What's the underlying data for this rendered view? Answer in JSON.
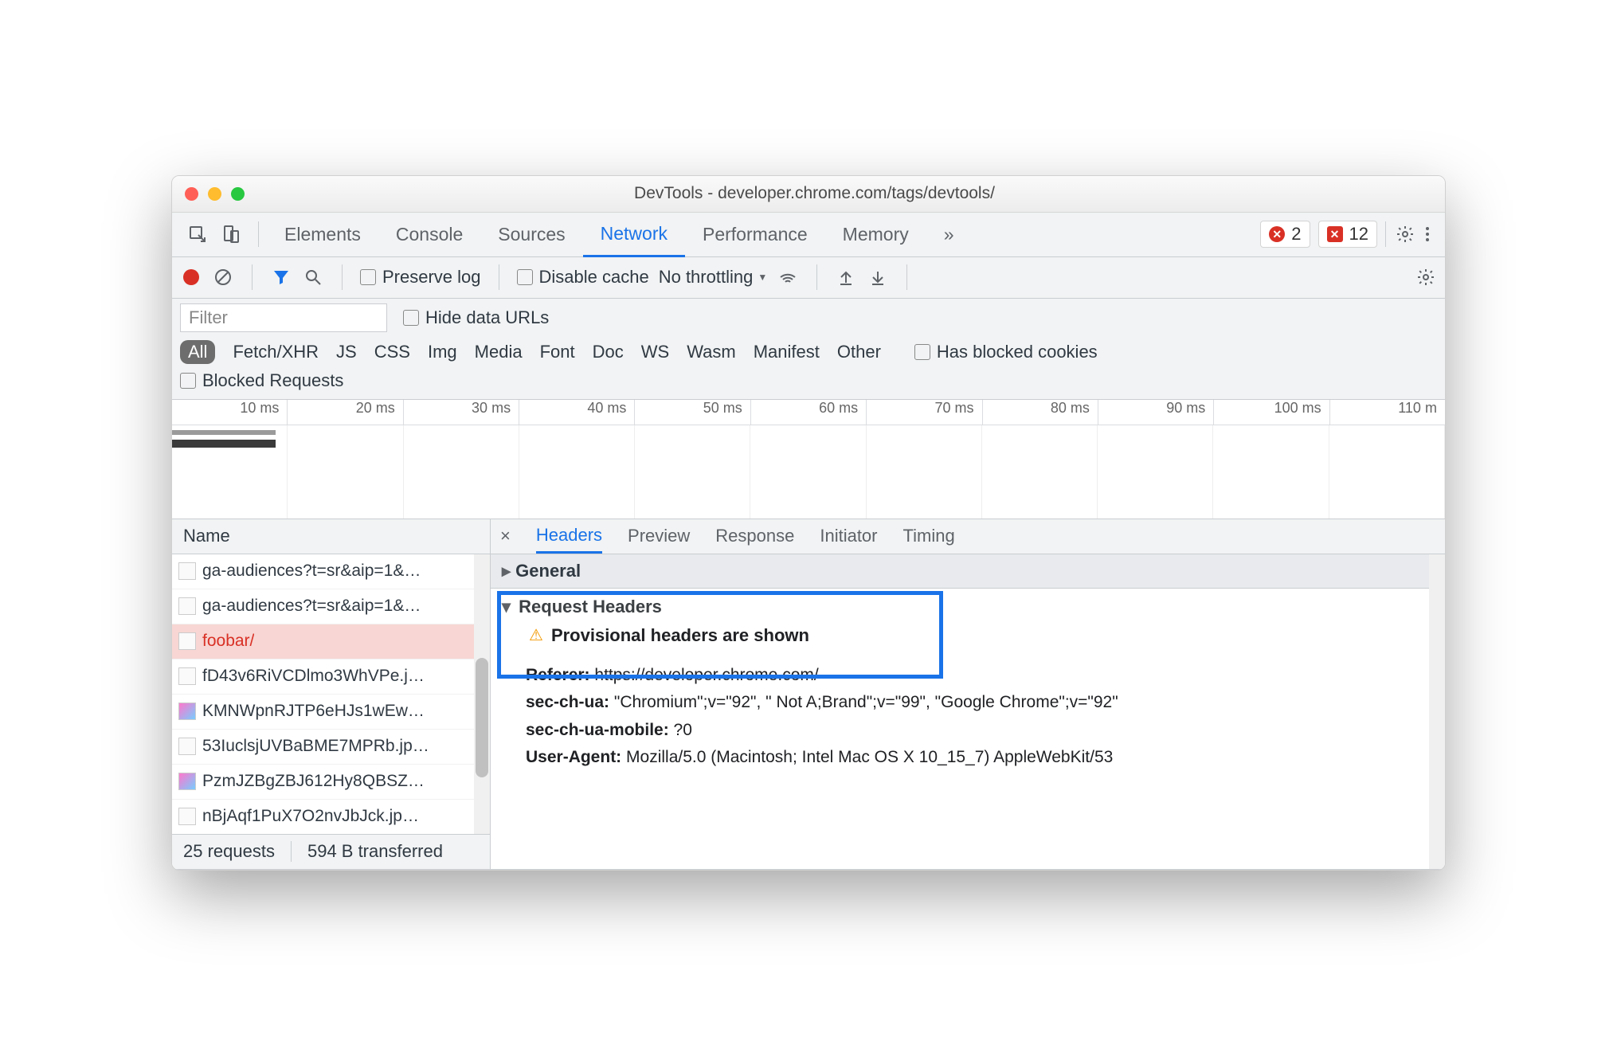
{
  "window": {
    "title": "DevTools - developer.chrome.com/tags/devtools/"
  },
  "tabbar": {
    "tabs": [
      "Elements",
      "Console",
      "Sources",
      "Network",
      "Performance",
      "Memory"
    ],
    "more": "»",
    "errors_round": "2",
    "errors_box": "12"
  },
  "toolbar": {
    "preserve_log": "Preserve log",
    "disable_cache": "Disable cache",
    "throttling": "No throttling"
  },
  "filter": {
    "placeholder": "Filter",
    "hide_data_urls": "Hide data URLs",
    "chips": [
      "All",
      "Fetch/XHR",
      "JS",
      "CSS",
      "Img",
      "Media",
      "Font",
      "Doc",
      "WS",
      "Wasm",
      "Manifest",
      "Other"
    ],
    "has_blocked": "Has blocked cookies",
    "blocked_requests": "Blocked Requests"
  },
  "timeline": {
    "ticks": [
      "10 ms",
      "20 ms",
      "30 ms",
      "40 ms",
      "50 ms",
      "60 ms",
      "70 ms",
      "80 ms",
      "90 ms",
      "100 ms",
      "110 m"
    ]
  },
  "names": {
    "header": "Name",
    "rows": [
      "ga-audiences?t=sr&aip=1&…",
      "ga-audiences?t=sr&aip=1&…",
      "foobar/",
      "fD43v6RiVCDlmo3WhVPe.j…",
      "KMNWpnRJTP6eHJs1wEw…",
      "53IuclsjUVBaBME7MPRb.jp…",
      "PzmJZBgZBJ612Hy8QBSZ…",
      "nBjAqf1PuX7O2nvJbJck.jp…"
    ]
  },
  "detail": {
    "tabs": [
      "Headers",
      "Preview",
      "Response",
      "Initiator",
      "Timing"
    ],
    "close": "×",
    "general": "General",
    "request_headers": "Request Headers",
    "provisional": "Provisional headers are shown",
    "headers": {
      "referer_k": "Referer:",
      "referer_v": "https://developer.chrome.com/",
      "ua_k": "sec-ch-ua:",
      "ua_v": "\"Chromium\";v=\"92\", \" Not A;Brand\";v=\"99\", \"Google Chrome\";v=\"92\"",
      "uam_k": "sec-ch-ua-mobile:",
      "uam_v": "?0",
      "agent_k": "User-Agent:",
      "agent_v": "Mozilla/5.0 (Macintosh; Intel Mac OS X 10_15_7) AppleWebKit/53"
    }
  },
  "status": {
    "requests": "25 requests",
    "transferred": "594 B transferred"
  }
}
